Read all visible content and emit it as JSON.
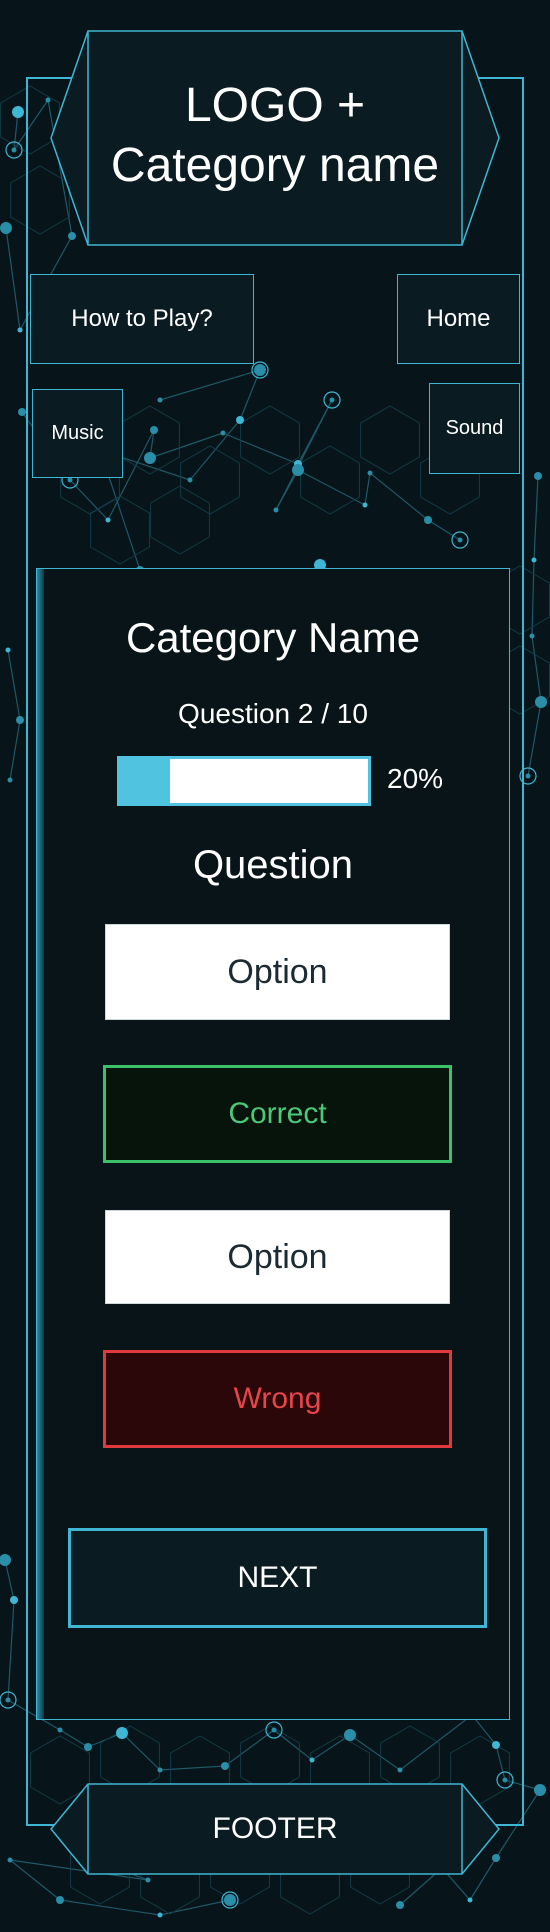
{
  "header": {
    "logo_text": "LOGO +\nCategory name"
  },
  "nav": {
    "how_to_play": "How to Play?",
    "home": "Home",
    "music": "Music",
    "sound": "Sound"
  },
  "quiz": {
    "category_title": "Category Name",
    "question_counter": "Question 2 / 10",
    "progress_percent": 20,
    "progress_label": "20%",
    "question_text": "Question",
    "options": [
      {
        "label": "Option",
        "state": "default"
      },
      {
        "label": "Correct",
        "state": "correct"
      },
      {
        "label": "Option",
        "state": "default"
      },
      {
        "label": "Wrong",
        "state": "wrong"
      }
    ],
    "next_label": "NEXT"
  },
  "footer": {
    "text": "FOOTER"
  },
  "colors": {
    "background": "#071419",
    "accent": "#3fb6d3",
    "progress_fill": "#4fc3df",
    "correct": "#3cc16b",
    "wrong": "#e03a3e"
  }
}
